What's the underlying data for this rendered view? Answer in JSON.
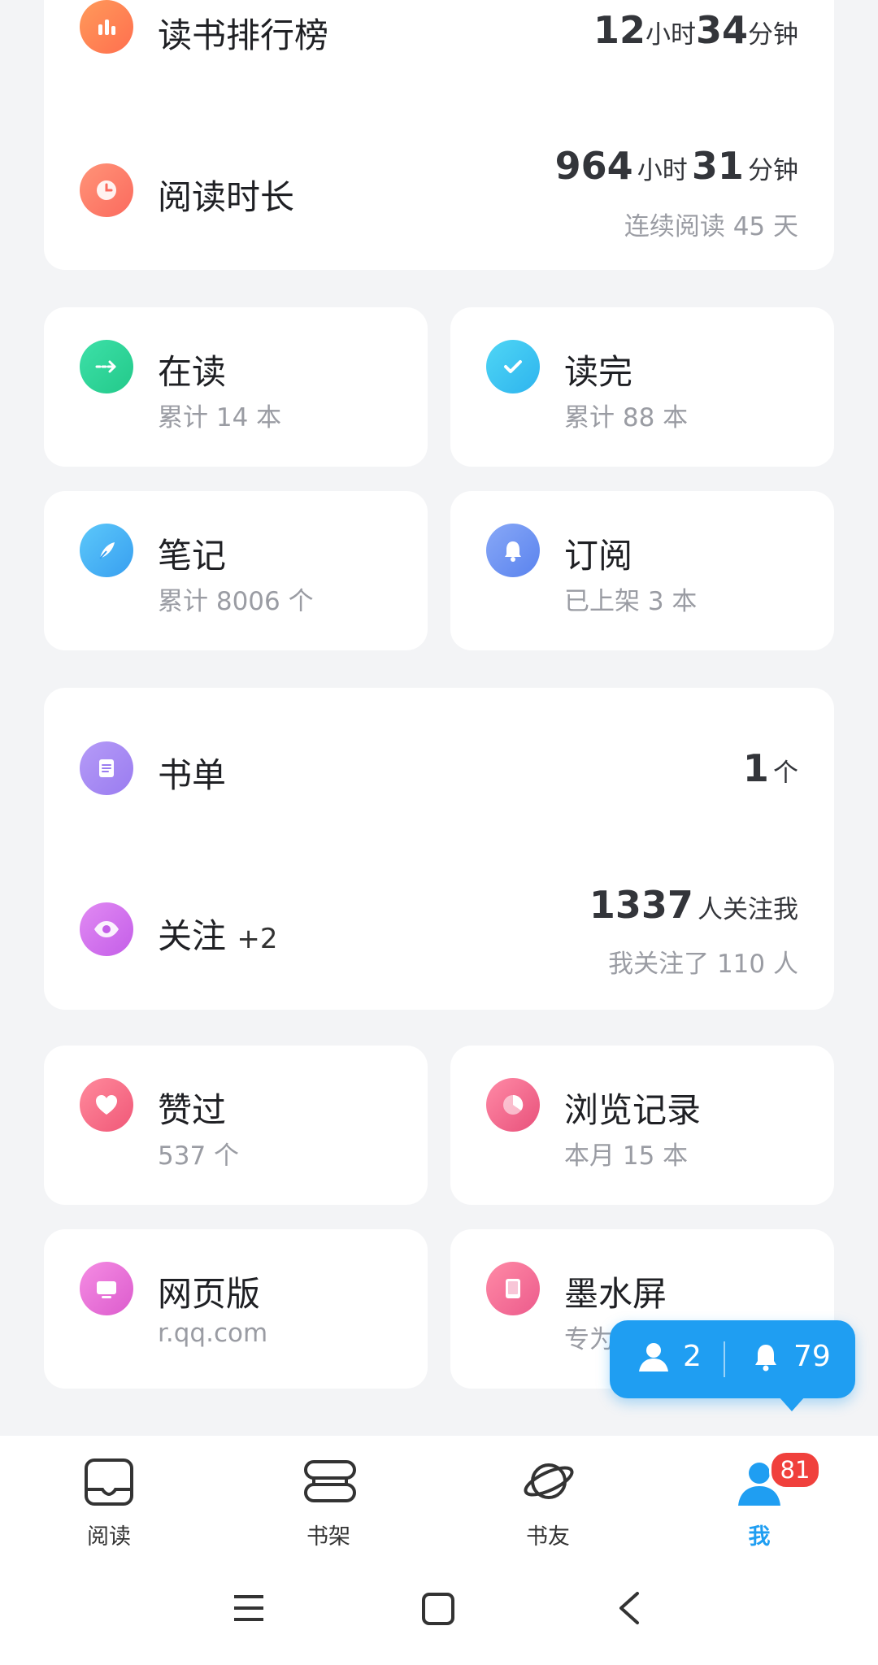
{
  "stats_card": {
    "ranking": {
      "title": "读书排行榜",
      "hours": "12",
      "hours_unit": "小时",
      "minutes": "34",
      "minutes_unit": "分钟",
      "icon": "bar-chart-icon"
    },
    "reading_time": {
      "title": "阅读时长",
      "hours": "964",
      "hours_unit": "小时",
      "minutes": "31",
      "minutes_unit": "分钟",
      "streak": "连续阅读 45 天",
      "icon": "clock-icon"
    }
  },
  "grid_row1": [
    {
      "title": "在读",
      "sub": "累计 14 本",
      "icon": "arrow-right-icon",
      "color": "#2fd59a"
    },
    {
      "title": "读完",
      "sub": "累计 88 本",
      "icon": "check-icon",
      "color": "#38c3f0"
    }
  ],
  "grid_row2": [
    {
      "title": "笔记",
      "sub": "累计 8006 个",
      "icon": "feather-icon",
      "color": "#46b7f5"
    },
    {
      "title": "订阅",
      "sub": "已上架 3 本",
      "icon": "bell-icon",
      "color": "#6f93f2"
    }
  ],
  "social_card": {
    "booklist": {
      "title": "书单",
      "count": "1",
      "count_unit": "个",
      "icon": "document-icon"
    },
    "follow": {
      "title": "关注",
      "plus": "+2",
      "followers": "1337",
      "followers_label": "人关注我",
      "following": "我关注了 110 人",
      "icon": "eye-icon"
    }
  },
  "grid_row3": [
    {
      "title": "赞过",
      "sub": "537 个",
      "icon": "heart-icon",
      "color": "#f36d86"
    },
    {
      "title": "浏览记录",
      "sub": "本月 15 本",
      "icon": "pie-icon",
      "color": "#f06a8c"
    }
  ],
  "grid_row4": [
    {
      "title": "网页版",
      "sub": "r.qq.com",
      "icon": "monitor-icon",
      "color": "#ec73d6"
    },
    {
      "title": "墨水屏",
      "sub": "专为",
      "icon": "eink-icon",
      "color": "#f2729a"
    }
  ],
  "bubble": {
    "friends": "2",
    "notifications": "79"
  },
  "tabs": [
    {
      "label": "阅读",
      "icon": "book-icon"
    },
    {
      "label": "书架",
      "icon": "shelf-icon"
    },
    {
      "label": "书友",
      "icon": "planet-icon"
    },
    {
      "label": "我",
      "icon": "person-icon",
      "badge": "81",
      "active_color": "#1f9ef2"
    }
  ]
}
